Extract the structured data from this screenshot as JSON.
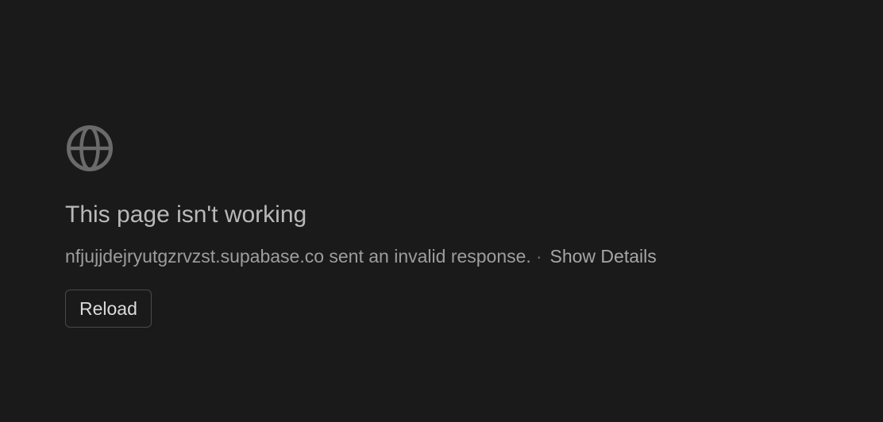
{
  "error": {
    "icon": "globe-icon",
    "title": "This page isn't working",
    "message": "nfjujjdejryutgzrvzst.supabase.co sent an invalid response.",
    "separator": "·",
    "details_link": "Show Details",
    "reload_label": "Reload"
  },
  "colors": {
    "background": "#1a1a1a",
    "title": "#b9b9b9",
    "message": "#9d9d9d",
    "icon": "#6a6a6a",
    "button_border": "#4a4a4a",
    "button_text": "#dadada"
  }
}
